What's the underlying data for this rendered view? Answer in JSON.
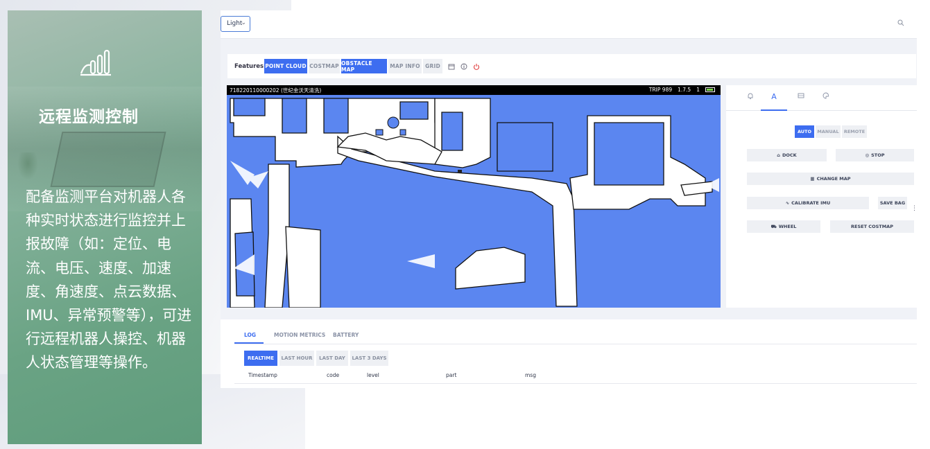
{
  "slide": {
    "title": "远程监测控制",
    "description": "配备监测平台对机器人各种实时状态进行监控并上报故障（如：定位、电流、电压、速度、加速度、角速度、点云数据、IMU、异常预警等），可进行远程机器人操控、机器人状态管理等操作。",
    "icon": "chart-icon",
    "accent_color": "#6aa384"
  },
  "topbar": {
    "theme_select_value": "Light",
    "search_icon": "search-icon"
  },
  "features": {
    "label": "Features:",
    "buttons": [
      {
        "label": "POINT CLOUD",
        "active": true
      },
      {
        "label": "COSTMAP",
        "active": false
      },
      {
        "label": "OBSTACLE MAP",
        "active": true
      },
      {
        "label": "MAP INFO",
        "active": false
      },
      {
        "label": "GRID",
        "active": false
      }
    ],
    "icons": [
      "calendar-icon",
      "info-icon",
      "power-icon"
    ]
  },
  "map": {
    "robot_id": "718220110000202 (世纪金沃天清洗)",
    "trip": "TRIP 989",
    "speed": "1.7.5",
    "signal": "1",
    "map_color": "#5b86f0"
  },
  "control": {
    "tabs": [
      {
        "icon": "bell-icon",
        "text": ""
      },
      {
        "icon": "a-icon",
        "text": "A"
      },
      {
        "icon": "grid-icon",
        "text": ""
      },
      {
        "icon": "palette-icon",
        "text": ""
      }
    ],
    "modes": [
      {
        "label": "AUTO",
        "active": true
      },
      {
        "label": "MANUAL",
        "active": false
      },
      {
        "label": "REMOTE",
        "active": false
      }
    ],
    "actions": {
      "dock": "DOCK",
      "stop": "STOP",
      "change_map": "CHANGE MAP",
      "calibrate_imu": "CALIBRATE IMU",
      "save_bag": "SAVE BAG",
      "wheel": "WHEEL",
      "reset_costmap": "RESET COSTMAP"
    }
  },
  "log": {
    "tabs": [
      "LOG",
      "MOTION METRICS",
      "BATTERY"
    ],
    "ranges": [
      {
        "label": "REALTIME",
        "active": true
      },
      {
        "label": "LAST HOUR",
        "active": false
      },
      {
        "label": "LAST DAY",
        "active": false
      },
      {
        "label": "LAST 3 DAYS",
        "active": false
      }
    ],
    "columns": [
      "Timestamp",
      "code",
      "level",
      "part",
      "msg"
    ]
  },
  "colors": {
    "primary": "#3d6df0",
    "idle_button": "#eef0f4",
    "panel_bg": "#f0f2f7"
  }
}
